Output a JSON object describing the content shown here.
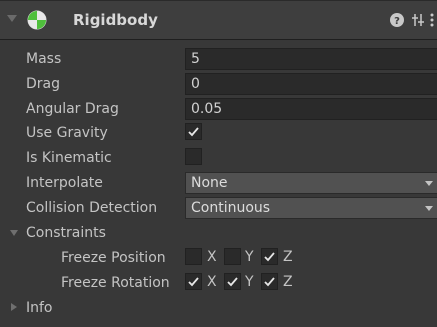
{
  "component": {
    "title": "Rigidbody",
    "icons": [
      "fold-arrow-icon",
      "rigidbody-icon",
      "help-icon",
      "preset-icon",
      "menu-icon"
    ]
  },
  "fields": {
    "mass": {
      "label": "Mass",
      "value": "5"
    },
    "drag": {
      "label": "Drag",
      "value": "0"
    },
    "angular_drag": {
      "label": "Angular Drag",
      "value": "0.05"
    },
    "use_gravity": {
      "label": "Use Gravity",
      "checked": true
    },
    "is_kinematic": {
      "label": "Is Kinematic",
      "checked": false
    },
    "interpolate": {
      "label": "Interpolate",
      "value": "None"
    },
    "collision_detection": {
      "label": "Collision Detection",
      "value": "Continuous"
    }
  },
  "constraints": {
    "label": "Constraints",
    "expanded": true,
    "freeze_position": {
      "label": "Freeze Position",
      "axes": [
        {
          "name": "X",
          "checked": false
        },
        {
          "name": "Y",
          "checked": false
        },
        {
          "name": "Z",
          "checked": true
        }
      ]
    },
    "freeze_rotation": {
      "label": "Freeze Rotation",
      "axes": [
        {
          "name": "X",
          "checked": true
        },
        {
          "name": "Y",
          "checked": true
        },
        {
          "name": "Z",
          "checked": true
        }
      ]
    }
  },
  "info": {
    "label": "Info",
    "expanded": false
  },
  "colors": {
    "background": "#383838",
    "header": "#3e3e3e",
    "field": "#2a2a2a",
    "dropdown": "#515151",
    "text": "#c4c4c4"
  }
}
